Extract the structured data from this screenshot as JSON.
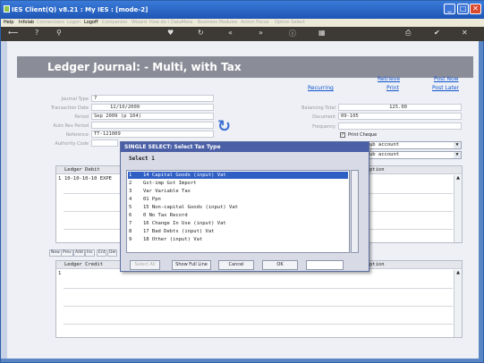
{
  "window": {
    "title": "IES Client(Q) v8.21 : My IES :     [mode-2]",
    "controls": [
      "_",
      "□",
      "✕"
    ]
  },
  "menu": [
    {
      "label": "Help",
      "enabled": true
    },
    {
      "label": "Infolab",
      "enabled": true
    },
    {
      "label": "Connections",
      "enabled": false
    },
    {
      "label": "Logon",
      "enabled": false
    },
    {
      "label": "Logoff",
      "enabled": true
    },
    {
      "label": "Companion",
      "enabled": false
    },
    {
      "label": "Wizard",
      "enabled": false
    },
    {
      "label": "How do I",
      "enabled": false
    },
    {
      "label": "DataMeta",
      "enabled": false
    },
    {
      "label": "Business Modules",
      "enabled": false
    },
    {
      "label": "Action Focus",
      "enabled": false
    },
    {
      "label": "Option Select",
      "enabled": false
    }
  ],
  "toolbar_icons": [
    "back-arrow-icon",
    "help-icon",
    "search-icon",
    "heart-icon",
    "refresh-icon",
    "double-left-icon",
    "double-right-icon",
    "info-icon",
    "grid-icon",
    "print-icon",
    "ok-icon",
    "close-icon"
  ],
  "form": {
    "title": "Ledger Journal: - Multi, with Tax",
    "links": {
      "retrieve": "Retrieve",
      "post_now": "Post Now",
      "recurring": "Recurring",
      "print": "Print",
      "post_later": "Post Later"
    },
    "labels": {
      "journal_type": "Journal Type",
      "transaction_date": "Transaction Date",
      "period": "Period",
      "auto_rev_period": "Auto Rev Period",
      "reference": "Reference",
      "authority_code": "Authority Code",
      "balancing_total": "Balancing Total",
      "document": "Document",
      "frequency": "Frequency"
    },
    "values": {
      "journal_type": "7",
      "transaction_date": "12/10/2009",
      "period": "Sep 2009 (p 104)",
      "auto_rev_period": "",
      "reference": "TT-121009",
      "authority_code": "",
      "balancing_total": "125.00",
      "document": "09-105",
      "frequency": ""
    },
    "print_cheque": {
      "label": "Print Cheque",
      "checked": true
    },
    "sub_account_1": "ub account",
    "sub_account_2": "ub account"
  },
  "debit_grid": {
    "headers": [
      "Ledger Debit",
      "ption"
    ],
    "rows": [
      {
        "no": "1",
        "text": "10-10-10-10 EXPE"
      }
    ]
  },
  "grid_buttons": [
    "New",
    "Prev",
    "Add",
    "Ins",
    "Ent",
    "Del"
  ],
  "credit_grid": {
    "headers": [
      "Ledger Credit",
      "ption"
    ],
    "rows": [
      {
        "no": "1",
        "text": ""
      }
    ]
  },
  "dialog": {
    "title": "SINGLE SELECT: Select Tax Type",
    "subtitle": "Select 1",
    "items": [
      {
        "no": "1",
        "text": "14 Capital Goods (input) Vat",
        "selected": true
      },
      {
        "no": "2",
        "text": "Gst-imp Gst Import",
        "selected": false
      },
      {
        "no": "3",
        "text": "Var Variable Tax",
        "selected": false
      },
      {
        "no": "4",
        "text": "01 Ppn",
        "selected": false
      },
      {
        "no": "5",
        "text": "15 Non-capital Goods (input) Vat",
        "selected": false
      },
      {
        "no": "6",
        "text": "0 No Tax Record",
        "selected": false
      },
      {
        "no": "7",
        "text": "16 Change In Use (input) Vat",
        "selected": false
      },
      {
        "no": "8",
        "text": "17 Bad Debts (input) Vat",
        "selected": false
      },
      {
        "no": "9",
        "text": "18 Other (input) Vat",
        "selected": false
      }
    ],
    "buttons": {
      "select_all": "Select All",
      "show_full_line": "Show Full Line",
      "cancel": "Cancel",
      "ok": "OK"
    },
    "search_value": ""
  },
  "colors": {
    "titlebar": "#2563c6",
    "header_band": "#8a8c97",
    "selection": "#2f5fc5",
    "link": "#1155cc"
  }
}
